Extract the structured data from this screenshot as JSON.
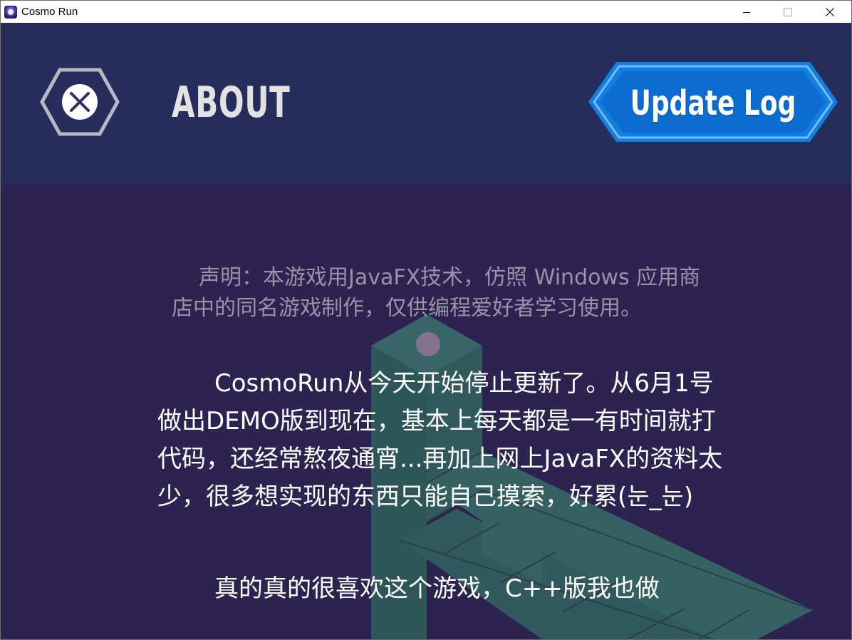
{
  "window": {
    "title": "Cosmo Run",
    "icon": "cosmo-run-app-icon",
    "controls": {
      "minimize_icon": "minimize-icon",
      "maximize_icon": "maximize-icon",
      "close_icon": "close-icon"
    }
  },
  "header": {
    "back_icon": "close-x-icon",
    "title": "ABOUT",
    "update_log_label": "Update Log"
  },
  "body": {
    "disclaimer": "声明：本游戏用JavaFX技术，仿照 Windows 应用商店中的同名游戏制作，仅供编程爱好者学习使用。",
    "paragraph_1": "CosmoRun从今天开始停止更新了。从6月1号做出DEMO版到现在，基本上每天都是一有时间就打代码，还经常熬夜通宵...再加上网上JavaFX的资料太少，很多想实现的东西只能自己摸索，好累(눈_눈)",
    "paragraph_2": "真的真的很喜欢这个游戏，C++版我也做"
  },
  "colors": {
    "header_bg": "#262d5a",
    "body_bg": "#2d2350",
    "accent_blue": "#1fa0f0",
    "accent_blue_dark": "#0a74d6",
    "tile_green": "#3b7a6b",
    "ball": "#8d7394"
  }
}
